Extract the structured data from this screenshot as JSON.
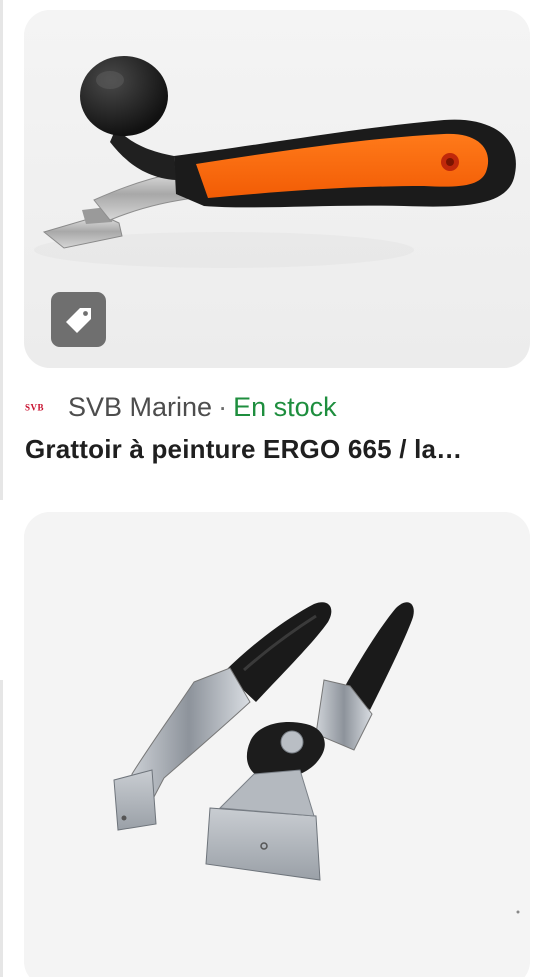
{
  "results": [
    {
      "image_alt": "Grattoir ERGO 665 orange and black handle",
      "has_tag_badge": true,
      "tag_icon": "price-tag-icon",
      "source_logo": "svb-logo",
      "source_logo_text": "SVB",
      "source_name": "SVB Marine",
      "separator": "·",
      "stock_status": "En stock",
      "title": "Grattoir à peinture ERGO 665 / la…",
      "colors": {
        "stock": "#1e8e3e",
        "logo": "#c8102e",
        "badge": "#6f6f6f"
      }
    },
    {
      "image_alt": "Two black handled paint scrapers with metal blades",
      "has_tag_badge": false
    }
  ]
}
